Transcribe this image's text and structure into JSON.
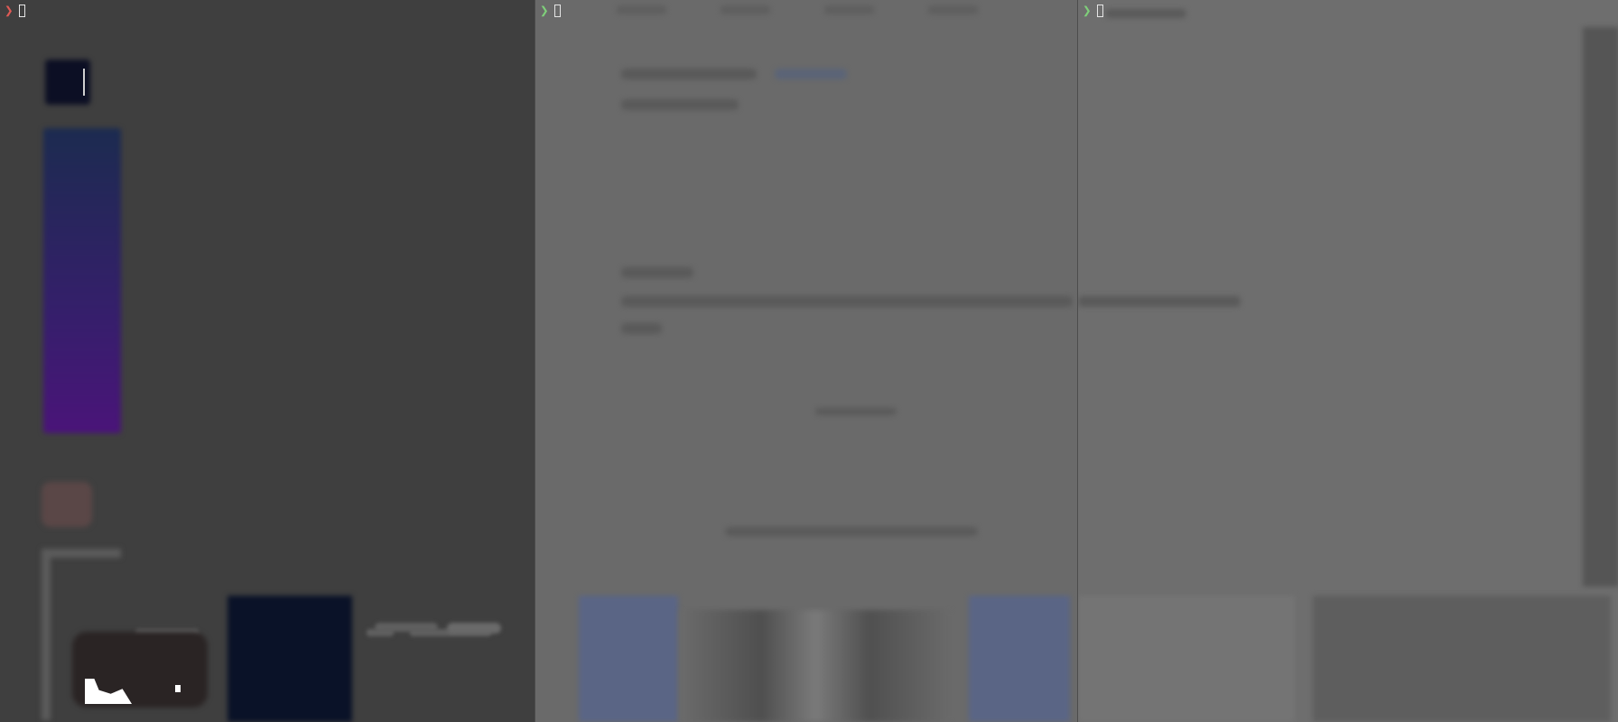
{
  "window": {
    "title": ""
  },
  "panes": [
    {
      "id": "pane-1",
      "prompt": "❯",
      "prompt_color": "#e05a55",
      "cursor": "⎕"
    },
    {
      "id": "pane-2",
      "prompt": "❯",
      "prompt_color": "#7fcf7a",
      "cursor": "⎕"
    },
    {
      "id": "pane-3",
      "prompt": "❯",
      "prompt_color": "#7fcf7a",
      "cursor": "⎕"
    }
  ],
  "colors": {
    "pane_left_bg": "#3f3f3f",
    "pane_mid_bg": "#6a6a6a",
    "pane_right_bg": "#6e6e6e",
    "divider": "#4c4c4c"
  }
}
